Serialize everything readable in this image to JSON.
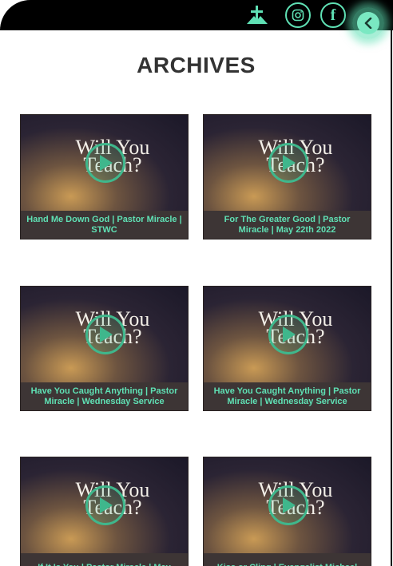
{
  "header": {
    "icons": [
      "cross-logo-icon",
      "instagram-icon",
      "facebook-icon",
      "chevron-left-icon"
    ],
    "facebook_glyph": "f",
    "accent_color": "#5fe0b4",
    "background_color": "#000000"
  },
  "page": {
    "title": "ARCHIVES"
  },
  "videos": [
    {
      "thumb_text": "Will You Teach?",
      "caption": "Hand Me Down God | Pastor Miracle | STWC"
    },
    {
      "thumb_text": "Will You Teach?",
      "caption": "For The Greater Good | Pastor Miracle | May 22th 2022"
    },
    {
      "thumb_text": "Will You Teach?",
      "caption": "Have You Caught Anything | Pastor Miracle | Wednesday Service"
    },
    {
      "thumb_text": "Will You Teach?",
      "caption": "Have You Caught Anything | Pastor Miracle | Wednesday Service"
    },
    {
      "thumb_text": "Will You Teach?",
      "caption": "If It Is You | Pastor Miracle | May"
    },
    {
      "thumb_text": "Will You Teach?",
      "caption": "Kiss or Cling | Evangelist Michael"
    }
  ]
}
